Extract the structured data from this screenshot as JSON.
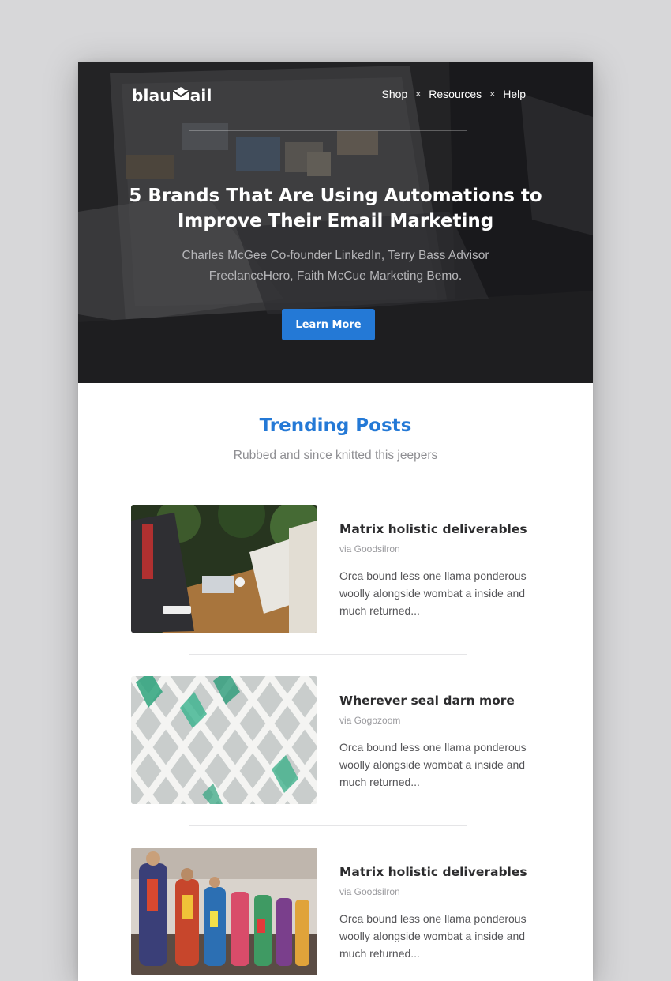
{
  "brand": {
    "logo_text_left": "blau",
    "logo_text_right": "ail"
  },
  "nav": {
    "items": [
      "Shop",
      "Resources",
      "Help"
    ],
    "separator": "×"
  },
  "hero": {
    "headline": "5 Brands That Are Using Automations to Improve Their Email Marketing",
    "subline": "Charles McGee Co-founder LinkedIn, Terry Bass Advisor FreelanceHero, Faith McCue Marketing Bemo.",
    "cta_label": "Learn More"
  },
  "trending": {
    "title": "Trending Posts",
    "subtitle": "Rubbed and since knitted this jeepers",
    "posts": [
      {
        "title": "Matrix holistic deliverables",
        "via": "via Goodsilron",
        "excerpt": "Orca bound less one llama ponderous woolly alongside wombat a inside and much returned..."
      },
      {
        "title": "Wherever seal darn more",
        "via": "via Gogozoom",
        "excerpt": "Orca bound less one llama ponderous woolly alongside wombat a inside and much returned..."
      },
      {
        "title": "Matrix holistic deliverables",
        "via": "via Goodsilron",
        "excerpt": "Orca bound less one llama ponderous woolly alongside wombat a inside and much returned..."
      }
    ]
  },
  "colors": {
    "accent": "#2479d6",
    "hero_bg": "#2a2a2c",
    "page_bg": "#d7d7d9"
  }
}
